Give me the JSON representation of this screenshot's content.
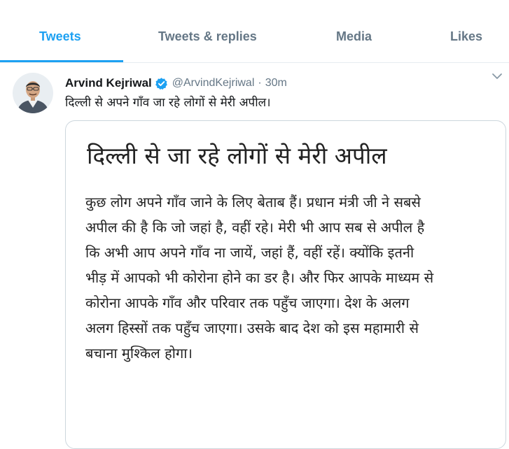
{
  "tabs": [
    {
      "label": "Tweets",
      "active": true
    },
    {
      "label": "Tweets & replies",
      "active": false
    },
    {
      "label": "Media",
      "active": false
    },
    {
      "label": "Likes",
      "active": false
    }
  ],
  "tweet": {
    "author": {
      "display_name": "Arvind Kejriwal",
      "verified": true,
      "handle": "@ArvindKejriwal",
      "separator": "·",
      "time": "30m",
      "avatar_icon": "profile-photo"
    },
    "text": "दिल्ली से अपने गाँव जा रहे लोगों से मेरी अपील।",
    "media": {
      "title": "दिल्ली से जा रहे लोगों से मेरी अपील",
      "lines": [
        "कुछ लोग अपने गाँव जाने के लिए बेताब हैं। प्रधान मंत्री जी ने सबसे",
        "अपील की है कि जो जहां है, वहीं रहे। मेरी भी आप सब से अपील है",
        "कि अभी आप अपने गाँव ना जायें, जहां हैं, वहीं रहें। क्योंकि इतनी",
        "भीड़ में आपको भी कोरोना होने का डर है। और फिर आपके माध्यम से",
        "कोरोना आपके गाँव और परिवार तक पहुँच जाएगा। देश के अलग",
        "अलग हिस्सों तक पहुँच जाएगा। उसके बाद देश को इस महामारी से",
        "बचाना मुश्किल होगा।"
      ]
    }
  },
  "colors": {
    "accent": "#1da1f2",
    "secondary_text": "#657786",
    "primary_text": "#14171a",
    "border": "#e6ecf0"
  },
  "icons": {
    "verified": "verified-badge-icon",
    "caret": "chevron-down-icon"
  }
}
